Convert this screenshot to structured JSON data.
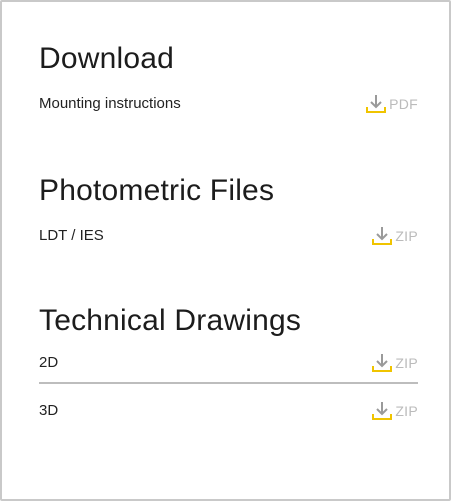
{
  "download": {
    "title": "Download",
    "items": [
      {
        "label": "Mounting instructions",
        "type": "PDF",
        "icon": "download-icon"
      }
    ]
  },
  "photometric": {
    "title": "Photometric Files",
    "items": [
      {
        "label": "LDT / IES",
        "type": "ZIP",
        "icon": "download-icon"
      }
    ]
  },
  "technical": {
    "title": "Technical Drawings",
    "items": [
      {
        "label": "2D",
        "type": "ZIP",
        "icon": "download-icon"
      },
      {
        "label": "3D",
        "type": "ZIP",
        "icon": "download-icon"
      }
    ]
  },
  "colors": {
    "icon_accent": "#f0c400",
    "icon_gray": "#9a9a9a",
    "type_text": "#bbbbbb",
    "divider": "#bdbdbd"
  }
}
